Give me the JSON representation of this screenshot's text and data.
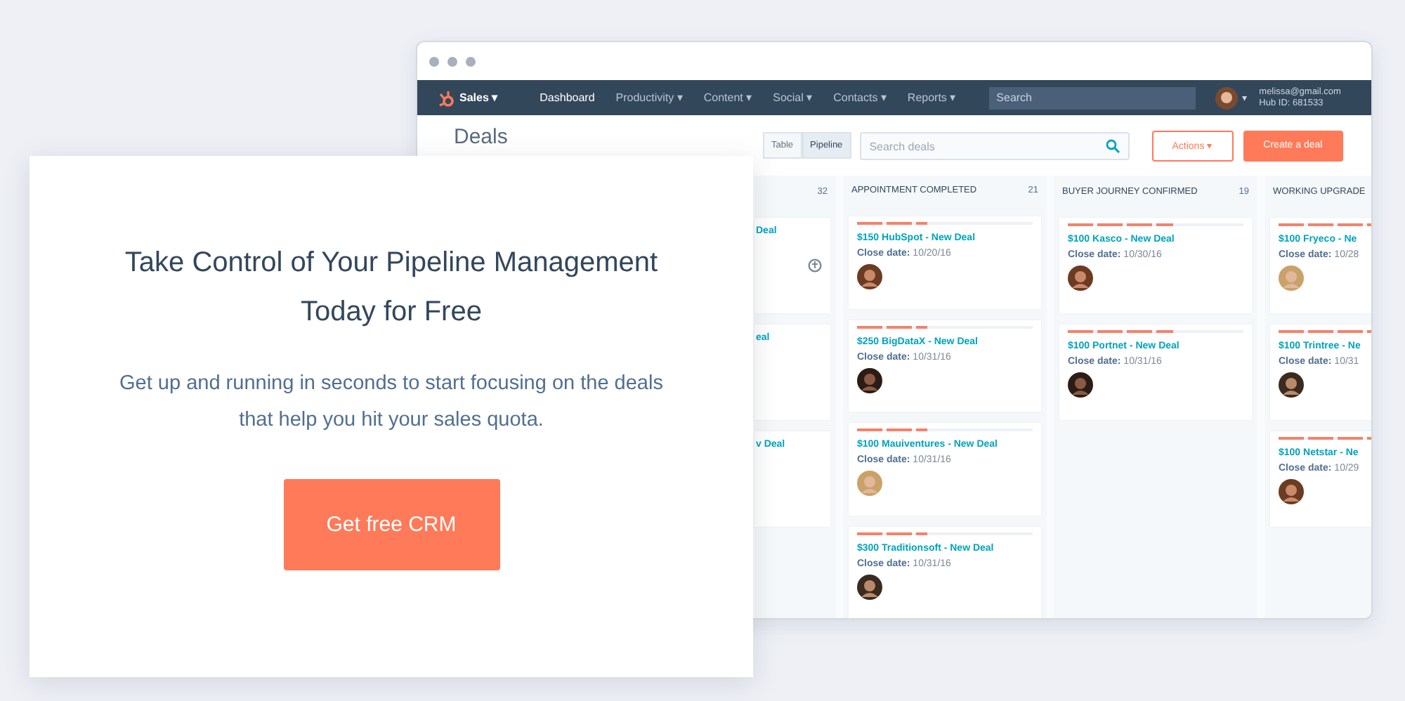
{
  "app_window": {
    "nav": {
      "app_menu": "Sales ▾",
      "items": [
        {
          "label": "Dashboard",
          "selected": true
        },
        {
          "label": "Productivity ▾",
          "selected": false
        },
        {
          "label": "Content ▾",
          "selected": false
        },
        {
          "label": "Social ▾",
          "selected": false
        },
        {
          "label": "Contacts ▾",
          "selected": false
        },
        {
          "label": "Reports ▾",
          "selected": false
        }
      ],
      "search": {
        "placeholder": "Search"
      },
      "account": {
        "caret": "▾",
        "email": "melissa@gmail.com",
        "hub_id": "Hub ID: 681533"
      }
    },
    "page_title": "Deals",
    "view_toggle": [
      {
        "label": "Table",
        "selected": false
      },
      {
        "label": "Pipeline",
        "selected": true
      }
    ],
    "deal_search": {
      "placeholder": "Search deals"
    },
    "actions_button": "Actions ▾",
    "create_button": "Create a deal",
    "columns": [
      {
        "count": "32",
        "cards": [
          {
            "title": "Deal",
            "icon": true
          },
          {
            "title": "eal"
          },
          {
            "title": "v Deal"
          }
        ]
      },
      {
        "name": "APPOINTMENT COMPLETED",
        "count": "21",
        "cards": [
          {
            "title": "$150 HubSpot - New Deal",
            "close": "**Close date:** 10/20/16",
            "level": 0.4
          },
          {
            "title": "$250 BigDataX - New Deal",
            "close": "**Close date:** 10/31/16",
            "level": 0.4
          },
          {
            "title": "$100 Mauiventures - New Deal",
            "close": "**Close date:** 10/31/16",
            "level": 0.4
          },
          {
            "title": "$300 Traditionsoft - New Deal",
            "close": "**Close date:** 10/31/16",
            "level": 0.4
          }
        ]
      },
      {
        "name": "BUYER JOURNEY CONFIRMED",
        "count": "19",
        "cards": [
          {
            "title": "$100 Kasco - New Deal",
            "close": "**Close date:** 10/30/16",
            "level": 0.6
          },
          {
            "title": "$100 Portnet - New Deal",
            "close": "**Close date:** 10/31/16",
            "level": 0.6
          }
        ]
      },
      {
        "name": "WORKING UPGRADE",
        "cards": [
          {
            "title": "$100 Fryeco - Ne",
            "close": "**Close date:** 10/28",
            "level": 0.8
          },
          {
            "title": "$100 Trintree - Ne",
            "close": "**Close date:** 10/31",
            "level": 0.8
          },
          {
            "title": "$100 Netstar - Ne",
            "close": "**Close date:** 10/29",
            "level": 0.8
          }
        ]
      }
    ]
  },
  "promo": {
    "heading": "Take Control of Your Pipeline Management Today for Free",
    "text": "Get up and running in seconds to start focusing on the deals that help you hit your sales quota.",
    "button": "Get free CRM"
  }
}
